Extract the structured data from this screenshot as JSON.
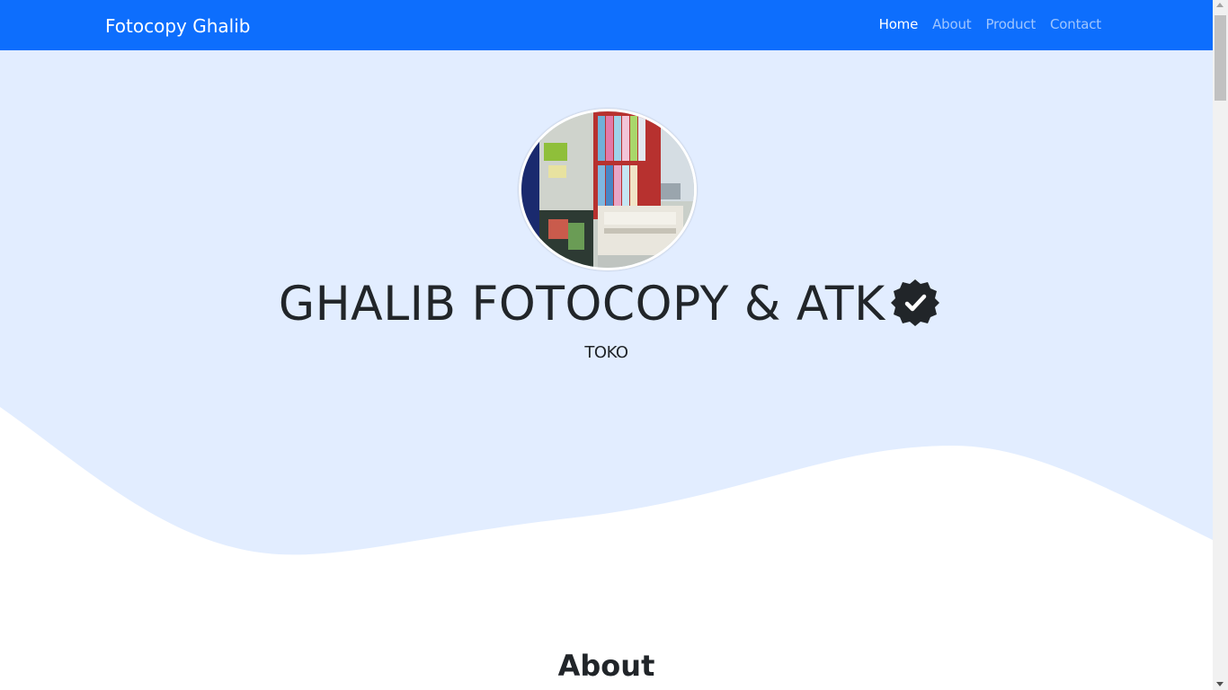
{
  "navbar": {
    "brand": "Fotocopy Ghalib",
    "links": [
      {
        "label": "Home",
        "active": true
      },
      {
        "label": "About",
        "active": false
      },
      {
        "label": "Product",
        "active": false
      },
      {
        "label": "Contact",
        "active": false
      }
    ]
  },
  "hero": {
    "title": "GHALIB FOTOCOPY & ATK",
    "subtitle": "TOKO",
    "verified_icon": "verified-badge-icon",
    "profile_image": "shop-photo"
  },
  "about": {
    "heading": "About"
  },
  "colors": {
    "navbar": "#0d6efd",
    "hero_bg": "#e2edff",
    "text": "#212529",
    "white": "#ffffff"
  }
}
